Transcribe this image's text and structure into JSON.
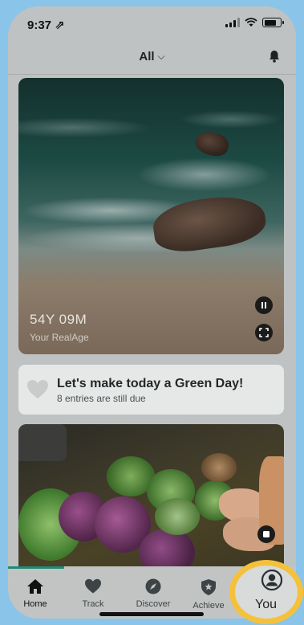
{
  "status": {
    "time": "9:37 ⇗"
  },
  "header": {
    "filter_label": "All",
    "bell": "bell-icon"
  },
  "hero": {
    "age": "54Y 09M",
    "caption": "Your RealAge"
  },
  "green_day": {
    "title": "Let's make today a Green Day!",
    "subtitle": "8 entries are still due"
  },
  "tabs": [
    {
      "label": "Home",
      "icon": "home-icon"
    },
    {
      "label": "Track",
      "icon": "heart-icon"
    },
    {
      "label": "Discover",
      "icon": "compass-icon"
    },
    {
      "label": "Achieve",
      "icon": "shield-star-icon"
    },
    {
      "label": "You",
      "icon": "user-icon"
    }
  ],
  "colors": {
    "accent": "#1f8b77",
    "highlight": "#f5c13b",
    "background": "#8ac4e9"
  }
}
